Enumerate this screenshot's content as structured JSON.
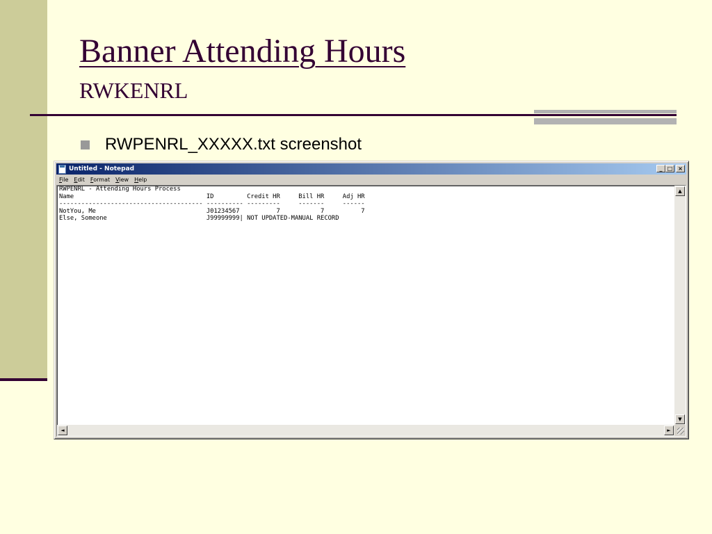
{
  "slide": {
    "title": "Banner Attending Hours",
    "subtitle": "RWKENRL",
    "bullet": "RWPENRL_XXXXX.txt screenshot"
  },
  "notepad": {
    "window_title": "Untitled - Notepad",
    "menu": [
      "File",
      "Edit",
      "Format",
      "View",
      "Help"
    ],
    "controls": {
      "minimize": "_",
      "maximize": "□",
      "close": "×"
    },
    "lines": [
      "RWPENRL - Attending Hours Process",
      "Name                                    ID         Credit HR     Bill HR     Adj HR",
      "--------------------------------------- ---------- ---------     -------     ------",
      "NotYou, Me                              J01234567          7           7          7",
      "Else, Someone                           J99999999| NOT UPDATED-MANUAL RECORD"
    ],
    "scroll_arrows": {
      "up": "▲",
      "down": "▼",
      "left": "◄",
      "right": "►"
    }
  }
}
